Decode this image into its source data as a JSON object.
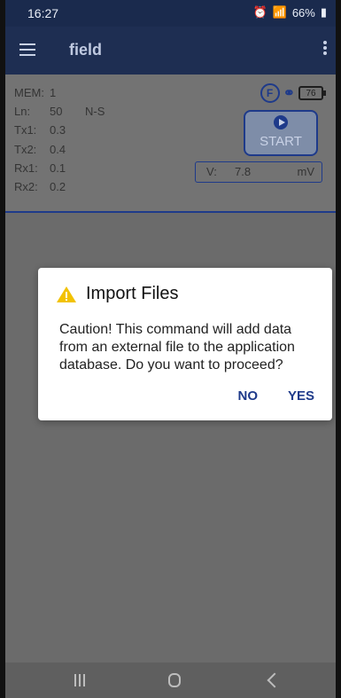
{
  "status_bar": {
    "time": "16:27",
    "battery_pct": "66%"
  },
  "app_bar": {
    "title": "field"
  },
  "panel": {
    "rows": [
      {
        "key": "MEM:",
        "value": "1",
        "extra": ""
      },
      {
        "key": "Ln:",
        "value": "50",
        "extra": "N-S"
      },
      {
        "key": "Tx1:",
        "value": "0.3",
        "extra": ""
      },
      {
        "key": "Tx2:",
        "value": "0.4",
        "extra": ""
      },
      {
        "key": "Rx1:",
        "value": "0.1",
        "extra": ""
      },
      {
        "key": "Rx2:",
        "value": "0.2",
        "extra": ""
      }
    ],
    "f_badge": "F",
    "battery_value": "76",
    "start_label": "START",
    "voltage_label": "V:",
    "voltage_value": "7.8",
    "voltage_unit": "mV"
  },
  "dialog": {
    "title": "Import Files",
    "body": "Caution! This command will add data from an external file to the application database. Do you want to proceed?",
    "no_label": "NO",
    "yes_label": "YES"
  },
  "colors": {
    "app_bar": "#1e2e52",
    "accent": "#1e3a8a",
    "warning": "#f2c200"
  },
  "icons": {
    "menu": "hamburger-icon",
    "more": "overflow-menu-icon",
    "link": "link-icon",
    "warning": "warning-icon",
    "play": "play-icon"
  }
}
